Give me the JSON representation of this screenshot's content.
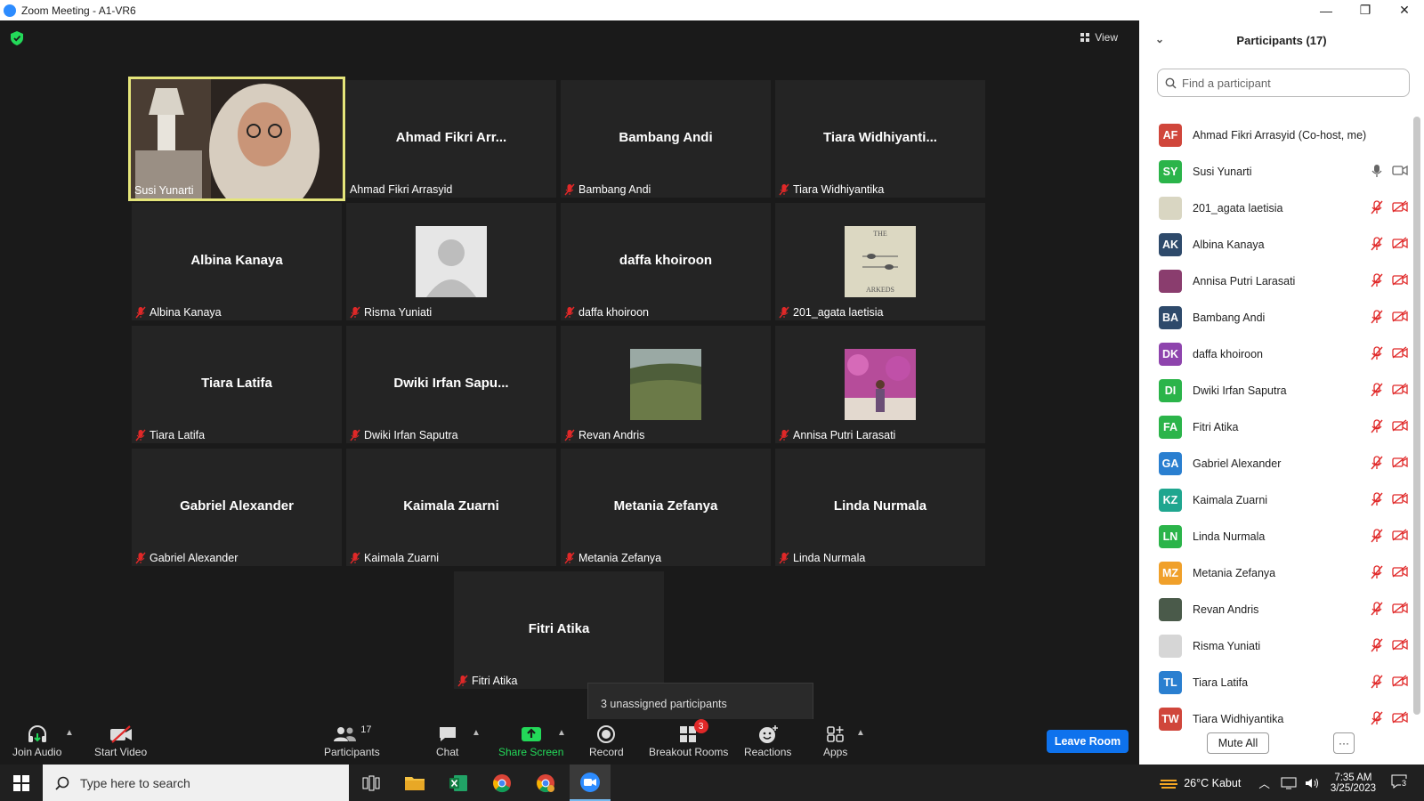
{
  "window": {
    "title": "Zoom Meeting - A1-VR6",
    "minimize": "—",
    "restore": "❐",
    "close": "✕"
  },
  "meeting": {
    "view_label": "View",
    "tiles": [
      {
        "big": "",
        "label": "Susi Yunarti",
        "muted": false,
        "kind": "video"
      },
      {
        "big": "Ahmad Fikri Arr...",
        "label": "Ahmad Fikri Arrasyid",
        "muted": false,
        "kind": "name"
      },
      {
        "big": "Bambang Andi",
        "label": "Bambang Andi",
        "muted": true,
        "kind": "name"
      },
      {
        "big": "Tiara  Widhiyanti...",
        "label": "Tiara Widhiyantika",
        "muted": true,
        "kind": "name"
      },
      {
        "big": "Albina Kanaya",
        "label": "Albina Kanaya",
        "muted": true,
        "kind": "name"
      },
      {
        "big": "",
        "label": "Risma Yuniati",
        "muted": true,
        "kind": "default-avatar"
      },
      {
        "big": "daffa khoiroon",
        "label": "daffa khoiroon",
        "muted": true,
        "kind": "name"
      },
      {
        "big": "",
        "label": "201_agata laetisia",
        "muted": true,
        "kind": "book-avatar"
      },
      {
        "big": "Tiara Latifa",
        "label": "Tiara Latifa",
        "muted": true,
        "kind": "name"
      },
      {
        "big": "Dwiki  Irfan Sapu...",
        "label": "Dwiki Irfan Saputra",
        "muted": true,
        "kind": "name"
      },
      {
        "big": "",
        "label": "Revan Andris",
        "muted": true,
        "kind": "landscape-avatar"
      },
      {
        "big": "",
        "label": "Annisa Putri Larasati",
        "muted": true,
        "kind": "flowers-avatar"
      },
      {
        "big": "Gabriel Alexander",
        "label": "Gabriel Alexander",
        "muted": true,
        "kind": "name"
      },
      {
        "big": "Kaimala Zuarni",
        "label": "Kaimala Zuarni",
        "muted": true,
        "kind": "name"
      },
      {
        "big": "Metania Zefanya",
        "label": "Metania Zefanya",
        "muted": true,
        "kind": "name"
      },
      {
        "big": "Linda Nurmala",
        "label": "Linda Nurmala",
        "muted": true,
        "kind": "name"
      },
      {
        "big": "Fitri Atika",
        "label": "Fitri Atika",
        "muted": true,
        "kind": "name"
      }
    ],
    "book_avatar_text": {
      "top": "THE",
      "bottom": "ARKEDS"
    },
    "tooltip": "3 unassigned participants"
  },
  "toolbar": {
    "join_audio": "Join Audio",
    "start_video": "Start Video",
    "participants": "Participants",
    "participants_count": "17",
    "chat": "Chat",
    "share_screen": "Share Screen",
    "record": "Record",
    "breakout_rooms": "Breakout Rooms",
    "breakout_badge": "3",
    "reactions": "Reactions",
    "apps": "Apps",
    "leave": "Leave Room",
    "share_color": "#23d959"
  },
  "panel": {
    "title": "Participants (17)",
    "search_placeholder": "Find a participant",
    "participants": [
      {
        "initials": "AF",
        "name": "Ahmad Fikri Arrasyid (Co-host, me)",
        "color": "#d0463b",
        "status": "none"
      },
      {
        "initials": "SY",
        "name": "Susi Yunarti",
        "color": "#2bb44a",
        "status": "on"
      },
      {
        "initials": "",
        "name": "201_agata laetisia",
        "color": "#d9d6c2",
        "status": "off"
      },
      {
        "initials": "AK",
        "name": "Albina Kanaya",
        "color": "#2e4a6b",
        "status": "off"
      },
      {
        "initials": "",
        "name": "Annisa Putri Larasati",
        "color": "#8a3d6e",
        "status": "off"
      },
      {
        "initials": "BA",
        "name": "Bambang Andi",
        "color": "#2e4a6b",
        "status": "off"
      },
      {
        "initials": "DK",
        "name": "daffa khoiroon",
        "color": "#8e44ad",
        "status": "off"
      },
      {
        "initials": "DI",
        "name": "Dwiki Irfan Saputra",
        "color": "#2bb44a",
        "status": "off"
      },
      {
        "initials": "FA",
        "name": "Fitri Atika",
        "color": "#2bb44a",
        "status": "off"
      },
      {
        "initials": "GA",
        "name": "Gabriel Alexander",
        "color": "#2a7fd0",
        "status": "off"
      },
      {
        "initials": "KZ",
        "name": "Kaimala Zuarni",
        "color": "#1fa68f",
        "status": "off"
      },
      {
        "initials": "LN",
        "name": "Linda Nurmala",
        "color": "#2bb44a",
        "status": "off"
      },
      {
        "initials": "MZ",
        "name": "Metania Zefanya",
        "color": "#f0a02a",
        "status": "off"
      },
      {
        "initials": "",
        "name": "Revan Andris",
        "color": "#4a5a4a",
        "status": "off"
      },
      {
        "initials": "",
        "name": "Risma Yuniati",
        "color": "#d6d6d6",
        "status": "off"
      },
      {
        "initials": "TL",
        "name": "Tiara Latifa",
        "color": "#2a7fd0",
        "status": "off"
      },
      {
        "initials": "TW",
        "name": "Tiara Widhiyantika",
        "color": "#d0463b",
        "status": "off"
      }
    ],
    "mute_all": "Mute All",
    "more": "···"
  },
  "taskbar": {
    "search_placeholder": "Type here to search",
    "weather": "26°C  Kabut",
    "time": "7:35 AM",
    "date": "3/25/2023",
    "notif_count": "3"
  }
}
